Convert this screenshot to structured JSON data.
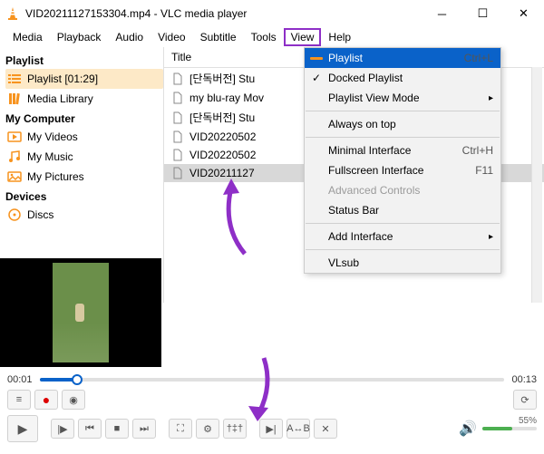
{
  "titlebar": {
    "title": "VID20211127153304.mp4 - VLC media player"
  },
  "menubar": {
    "items": [
      "Media",
      "Playback",
      "Audio",
      "Video",
      "Subtitle",
      "Tools",
      "View",
      "Help"
    ],
    "highlighted_index": 6
  },
  "sidebar": {
    "sections": [
      {
        "heading": "Playlist",
        "items": [
          {
            "label": "Playlist [01:29]",
            "icon": "playlist-icon",
            "selected": true
          },
          {
            "label": "Media Library",
            "icon": "media-library-icon",
            "selected": false
          }
        ]
      },
      {
        "heading": "My Computer",
        "items": [
          {
            "label": "My Videos",
            "icon": "videos-icon",
            "selected": false
          },
          {
            "label": "My Music",
            "icon": "music-icon",
            "selected": false
          },
          {
            "label": "My Pictures",
            "icon": "pictures-icon",
            "selected": false
          }
        ]
      },
      {
        "heading": "Devices",
        "items": [
          {
            "label": "Discs",
            "icon": "disc-icon",
            "selected": false
          }
        ]
      }
    ]
  },
  "filelist": {
    "column": "Title",
    "rows": [
      {
        "label": "[단독버전] Stu",
        "selected": false
      },
      {
        "label": "my blu-ray Mov",
        "selected": false
      },
      {
        "label": "[단독버전] Stu",
        "selected": false
      },
      {
        "label": "VID20220502",
        "selected": false
      },
      {
        "label": "VID20220502",
        "selected": false
      },
      {
        "label": "VID20211127",
        "selected": true
      }
    ]
  },
  "view_menu": {
    "items": [
      {
        "label": "Playlist",
        "shortcut": "Ctrl+L",
        "selected": true
      },
      {
        "label": "Docked Playlist",
        "checked": true
      },
      {
        "label": "Playlist View Mode",
        "submenu": true
      },
      {
        "separator": true
      },
      {
        "label": "Always on top"
      },
      {
        "separator": true
      },
      {
        "label": "Minimal Interface",
        "shortcut": "Ctrl+H"
      },
      {
        "label": "Fullscreen Interface",
        "shortcut": "F11"
      },
      {
        "label": "Advanced Controls",
        "disabled": true
      },
      {
        "label": "Status Bar"
      },
      {
        "separator": true
      },
      {
        "label": "Add Interface",
        "submenu": true
      },
      {
        "separator": true
      },
      {
        "label": "VLsub"
      }
    ]
  },
  "time": {
    "current": "00:01",
    "total": "00:13",
    "progress_pct": 8
  },
  "volume": {
    "label": "55%",
    "pct": 55
  },
  "colors": {
    "highlight": "#8e2fc7",
    "menu_sel": "#0a62c9",
    "orange": "#f7931e"
  }
}
